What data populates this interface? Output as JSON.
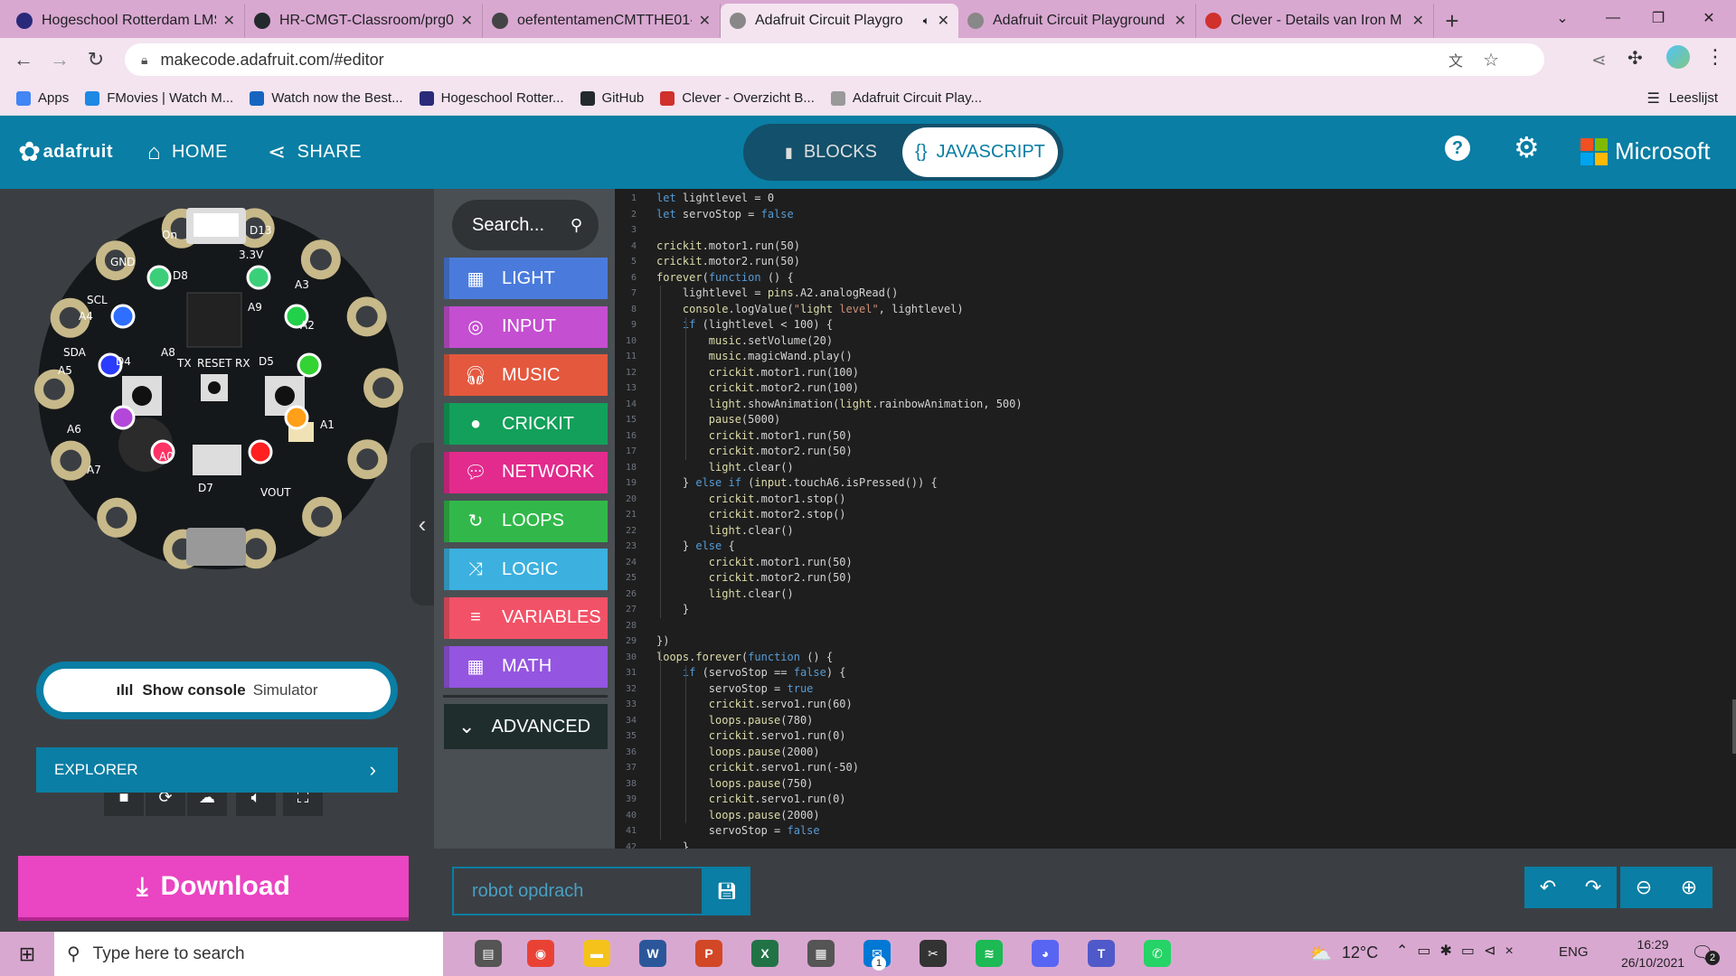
{
  "browser": {
    "tabs": [
      {
        "title": "Hogeschool Rotterdam LMS",
        "favicon": "hr-icon",
        "color": "#2a2a7a"
      },
      {
        "title": "HR-CMGT-Classroom/prg0",
        "favicon": "github-icon",
        "color": "#24292e"
      },
      {
        "title": "oefententamenCMTTHE01-",
        "favicon": "globe-icon",
        "color": "#444"
      },
      {
        "title": "Adafruit Circuit Playgro",
        "favicon": "star-icon",
        "color": "#888",
        "active": true
      },
      {
        "title": "Adafruit Circuit Playground",
        "favicon": "star-icon",
        "color": "#888"
      },
      {
        "title": "Clever - Details van Iron M",
        "favicon": "clever-icon",
        "color": "#d0312d"
      }
    ],
    "new_tab": "+",
    "url": "makecode.adafruit.com/#editor",
    "bookmarks": [
      {
        "label": "Apps",
        "color": "#4285f4"
      },
      {
        "label": "FMovies | Watch M...",
        "color": "#1e88e5"
      },
      {
        "label": "Watch now the Best...",
        "color": "#1565c0"
      },
      {
        "label": "Hogeschool Rotter...",
        "color": "#2a2a7a"
      },
      {
        "label": "GitHub",
        "color": "#24292e"
      },
      {
        "label": "Clever - Overzicht B...",
        "color": "#d0312d"
      },
      {
        "label": "Adafruit Circuit Play...",
        "color": "#999"
      }
    ],
    "reading_list": "Leeslijst"
  },
  "header": {
    "logo": "adafruit",
    "home": "HOME",
    "share": "SHARE",
    "blocks": "BLOCKS",
    "javascript": "JAVASCRIPT",
    "microsoft": "Microsoft",
    "accent": "#0a7ea4"
  },
  "simulator": {
    "show_console": "Show console",
    "simulator_label": "Simulator",
    "explorer": "EXPLORER",
    "board_labels": {
      "on": "On",
      "d13": "D13",
      "gnd": "GND",
      "d8": "D8",
      "scl": "SCL",
      "a4": "A4",
      "a9": "A9",
      "a8": "A8",
      "sda": "SDA",
      "a5": "A5",
      "d4": "D4",
      "tx": "TX",
      "reset": "RESET",
      "rx": "RX",
      "d5": "D5",
      "a1": "A1",
      "a6": "A6",
      "a7": "A7",
      "a0": "A0",
      "d7": "D7",
      "vout": "VOUT",
      "v33": "3.3V",
      "a2": "A2",
      "a3": "A3"
    }
  },
  "toolbox": {
    "search_placeholder": "Search...",
    "categories": [
      {
        "label": "LIGHT",
        "color": "#4a7bdc",
        "icon": "grid-icon"
      },
      {
        "label": "INPUT",
        "color": "#c44fd0",
        "icon": "target-icon"
      },
      {
        "label": "MUSIC",
        "color": "#e4583e",
        "icon": "headphones-icon"
      },
      {
        "label": "CRICKIT",
        "color": "#13a05a",
        "icon": "circle-icon"
      },
      {
        "label": "NETWORK",
        "color": "#e22b8d",
        "icon": "chat-icon"
      },
      {
        "label": "LOOPS",
        "color": "#32b84a",
        "icon": "refresh-icon"
      },
      {
        "label": "LOGIC",
        "color": "#3cb0de",
        "icon": "shuffle-icon"
      },
      {
        "label": "VARIABLES",
        "color": "#f25267",
        "icon": "lines-icon"
      },
      {
        "label": "MATH",
        "color": "#9455e0",
        "icon": "calculator-icon"
      }
    ],
    "advanced": "ADVANCED"
  },
  "editor": {
    "lines": [
      "let lightlevel = 0",
      "let servoStop = false",
      "",
      "crickit.motor1.run(50)",
      "crickit.motor2.run(50)",
      "forever(function () {",
      "    lightlevel = pins.A2.analogRead()",
      "    console.logValue(\"light level\", lightlevel)",
      "    if (lightlevel < 100) {",
      "        music.setVolume(20)",
      "        music.magicWand.play()",
      "        crickit.motor1.run(100)",
      "        crickit.motor2.run(100)",
      "        light.showAnimation(light.rainbowAnimation, 500)",
      "        pause(5000)",
      "        crickit.motor1.run(50)",
      "        crickit.motor2.run(50)",
      "        light.clear()",
      "    } else if (input.touchA6.isPressed()) {",
      "        crickit.motor1.stop()",
      "        crickit.motor2.stop()",
      "        light.clear()",
      "    } else {",
      "        crickit.motor1.run(50)",
      "        crickit.motor2.run(50)",
      "        light.clear()",
      "    }",
      "",
      "})",
      "loops.forever(function () {",
      "    if (servoStop == false) {",
      "        servoStop = true",
      "        crickit.servo1.run(60)",
      "        loops.pause(780)",
      "        crickit.servo1.run(0)",
      "        loops.pause(2000)",
      "        crickit.servo1.run(-50)",
      "        loops.pause(750)",
      "        crickit.servo1.run(0)",
      "        loops.pause(2000)",
      "        servoStop = false",
      "    }",
      "})"
    ]
  },
  "bottom": {
    "download": "Download",
    "project_name": "robot opdrach"
  },
  "taskbar": {
    "search_placeholder": "Type here to search",
    "weather": "12°C",
    "language": "ENG",
    "time": "16:29",
    "date": "26/10/2021",
    "notification_count": "1",
    "notification_badge": "2"
  }
}
